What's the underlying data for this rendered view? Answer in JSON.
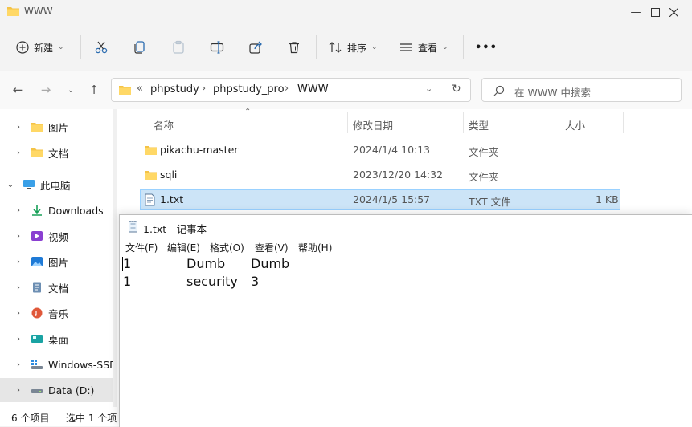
{
  "window": {
    "title": "WWW"
  },
  "toolbar": {
    "new_label": "新建",
    "sort_label": "排序",
    "view_label": "查看",
    "more_label": "•••"
  },
  "address": {
    "overflow": "«",
    "crumbs": [
      "phpstudy",
      "phpstudy_pro",
      "WWW"
    ],
    "search_placeholder": "在 WWW 中搜索"
  },
  "nav": {
    "items": [
      {
        "label": "图片"
      },
      {
        "label": "文档"
      },
      {
        "label": "此电脑"
      },
      {
        "label": "Downloads"
      },
      {
        "label": "视频"
      },
      {
        "label": "图片"
      },
      {
        "label": "文档"
      },
      {
        "label": "音乐"
      },
      {
        "label": "桌面"
      },
      {
        "label": "Windows-SSD"
      },
      {
        "label": "Data (D:)"
      }
    ]
  },
  "columns": {
    "name": "名称",
    "modified": "修改日期",
    "type": "类型",
    "size": "大小"
  },
  "files": [
    {
      "name": "pikachu-master",
      "modified": "2024/1/4 10:13",
      "type": "文件夹",
      "size": ""
    },
    {
      "name": "sqli",
      "modified": "2023/12/20 14:32",
      "type": "文件夹",
      "size": ""
    },
    {
      "name": "1.txt",
      "modified": "2024/1/5 15:57",
      "type": "TXT 文件",
      "size": "1 KB"
    }
  ],
  "status": {
    "count": "6 个项目",
    "selected": "选中 1 个项"
  },
  "notepad": {
    "title": "1.txt - 记事本",
    "menu": [
      "文件(F)",
      "编辑(E)",
      "格式(O)",
      "查看(V)",
      "帮助(H)"
    ],
    "lines": [
      [
        "1",
        "Dumb",
        "Dumb"
      ],
      [
        "1",
        "security",
        "3"
      ]
    ]
  },
  "colors": {
    "accent": "#0067c0",
    "selection": "#cce4f7",
    "selection_border": "#99d1ff",
    "folder": "#f4c347"
  }
}
